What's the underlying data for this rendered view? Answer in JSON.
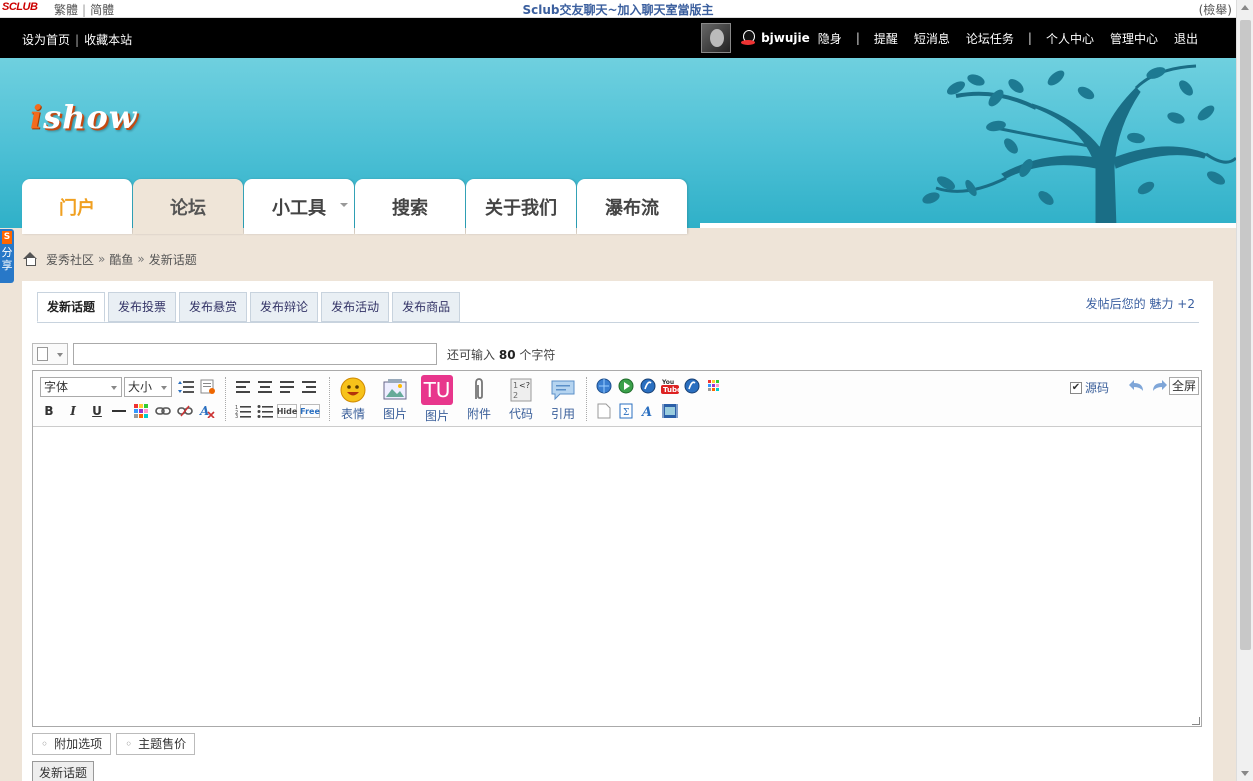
{
  "top_strip": {
    "logo": "SCLUB",
    "lang_trad": "繁體",
    "lang_simp": "简體",
    "title": "Sclub交友聊天~加入聊天室當版主",
    "right_link": "(檢舉)"
  },
  "black_bar": {
    "set_home": "设为首页",
    "bookmark": "收藏本站",
    "username": "bjwujie",
    "invisible": "隐身",
    "remind": "提醒",
    "messages": "短消息",
    "tasks": "论坛任务",
    "profile": "个人中心",
    "admin": "管理中心",
    "logout": "退出"
  },
  "banner": {
    "brand_i": "i",
    "brand_rest": "show"
  },
  "nav": {
    "tabs": [
      "门户",
      "论坛",
      "小工具",
      "搜索",
      "关于我们",
      "瀑布流"
    ]
  },
  "share": {
    "s": "S",
    "label": "分享"
  },
  "breadcrumb": {
    "items": [
      "爱秀社区",
      "酷鱼",
      "发新话题"
    ],
    "sep": "»"
  },
  "post_tabs": [
    "发新话题",
    "发布投票",
    "发布悬赏",
    "发布辩论",
    "发布活动",
    "发布商品"
  ],
  "charm_text": "发帖后您的 魅力 +2",
  "subject": {
    "remain_prefix": "还可输入",
    "remain_count": "80",
    "remain_suffix": "个字符"
  },
  "toolbar": {
    "font_label": "字体",
    "size_label": "大小",
    "bold": "B",
    "italic": "I",
    "underline": "U",
    "hide": "Hide",
    "free": "Free",
    "emoji": "表情",
    "image": "图片",
    "tu_image": "图片",
    "tu_logo": "TU",
    "attach": "附件",
    "code": "代码",
    "quote": "引用",
    "source": "源码",
    "fullscreen": "全屏"
  },
  "extra": {
    "options": "附加选项",
    "price": "主题售价"
  },
  "submit_label": "发新话题",
  "colors": {
    "banner": "#4fc1d6",
    "link": "#3a5fa0",
    "portal_tab": "#f0a020",
    "bg": "#eee4d8"
  }
}
